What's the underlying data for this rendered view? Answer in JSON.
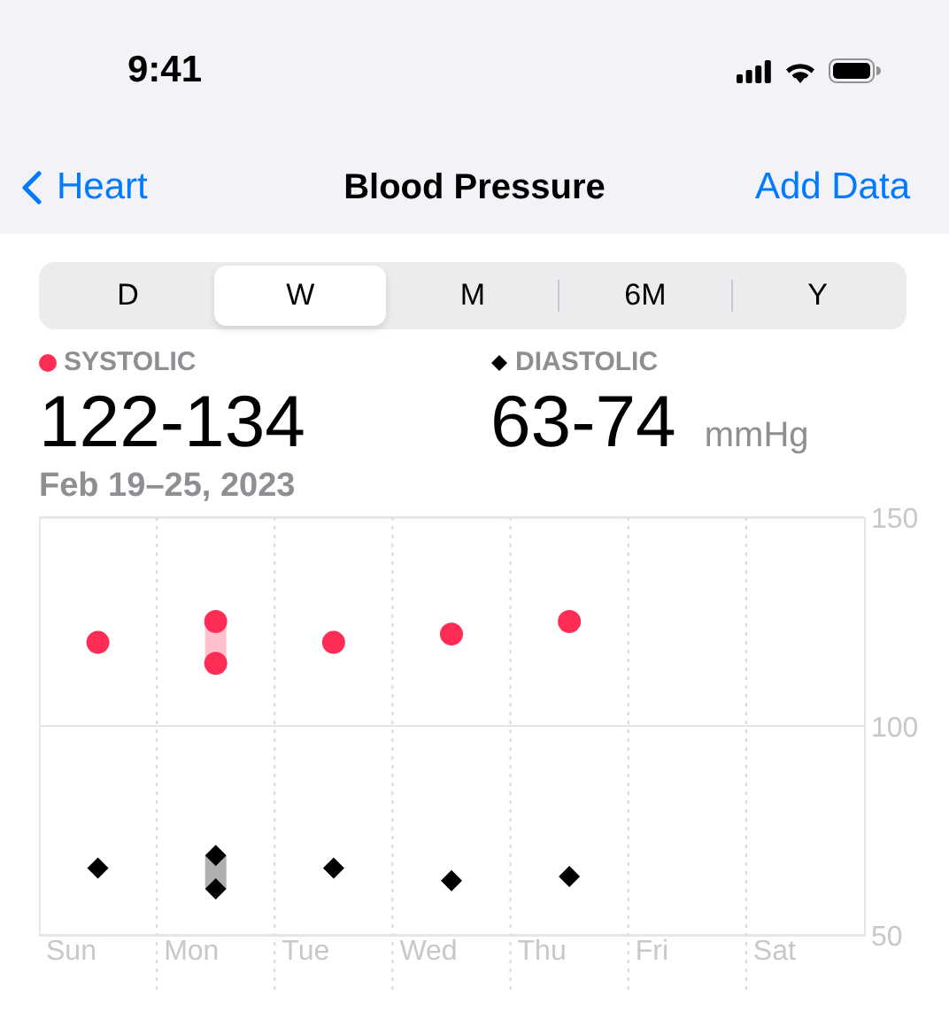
{
  "status_bar": {
    "time": "9:41"
  },
  "nav": {
    "back": "Heart",
    "title": "Blood Pressure",
    "action": "Add Data"
  },
  "segments": [
    {
      "label": "D",
      "selected": false
    },
    {
      "label": "W",
      "selected": true
    },
    {
      "label": "M",
      "selected": false
    },
    {
      "label": "6M",
      "selected": false
    },
    {
      "label": "Y",
      "selected": false
    }
  ],
  "summary": [
    {
      "kind": "dot",
      "label": "SYSTOLIC",
      "color": "#ff2d55",
      "value": "122-134"
    },
    {
      "kind": "diamond",
      "label": "DIASTOLIC",
      "color": "#000000",
      "value": "63-74",
      "unit": "mmHg"
    }
  ],
  "date_range": "Feb 19–25, 2023",
  "chart": {
    "chart_data": {
      "type": "scatter",
      "categories": [
        "Sun",
        "Mon",
        "Tue",
        "Wed",
        "Thu",
        "Fri",
        "Sat"
      ],
      "ylim": [
        50,
        150
      ],
      "yticks": [
        50,
        100,
        150
      ],
      "series": [
        {
          "color": "#ff2d55",
          "values": [
            120,
            125,
            120,
            122,
            125,
            null,
            null
          ]
        },
        {
          "color": "#ff2d55",
          "values": [
            null,
            115,
            null,
            null,
            null,
            null,
            null
          ]
        },
        {
          "color": "#000000",
          "values": [
            66,
            69,
            66,
            63,
            64,
            null,
            null
          ]
        },
        {
          "color": "#000000",
          "values": [
            null,
            61,
            null,
            null,
            null,
            null,
            null
          ]
        }
      ]
    }
  }
}
